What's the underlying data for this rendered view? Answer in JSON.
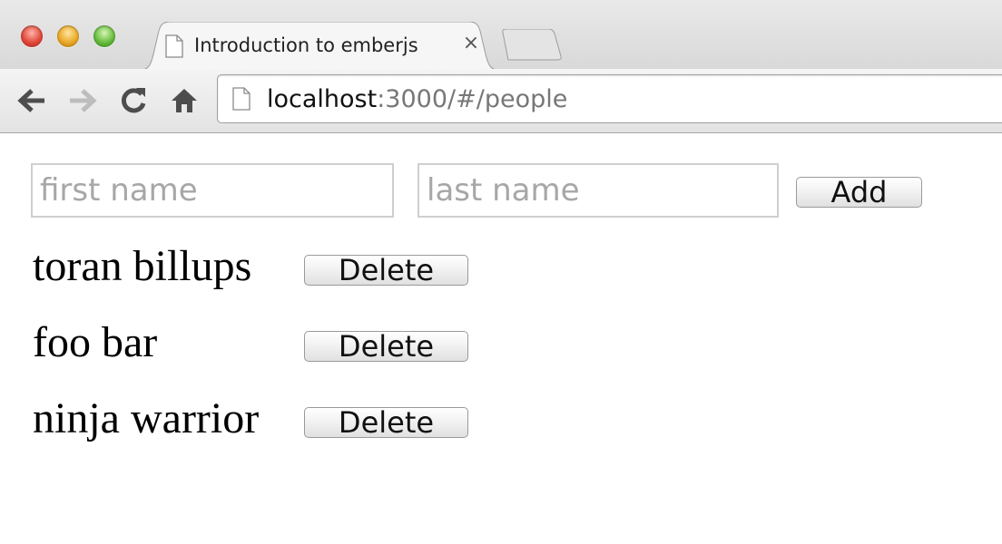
{
  "browser": {
    "tab_title": "Introduction to emberjs",
    "tab_close": "×",
    "url_host": "localhost",
    "url_rest": ":3000/#/people",
    "icons": [
      "back-arrow-icon",
      "forward-arrow-icon",
      "reload-icon",
      "home-icon",
      "page-icon",
      "close-icon"
    ]
  },
  "form": {
    "first_name_placeholder": "first name",
    "first_name_value": "",
    "last_name_placeholder": "last name",
    "last_name_value": "",
    "add_label": "Add"
  },
  "people": [
    {
      "name": "toran billups",
      "delete_label": "Delete"
    },
    {
      "name": "foo bar",
      "delete_label": "Delete"
    },
    {
      "name": "ninja warrior",
      "delete_label": "Delete"
    }
  ]
}
